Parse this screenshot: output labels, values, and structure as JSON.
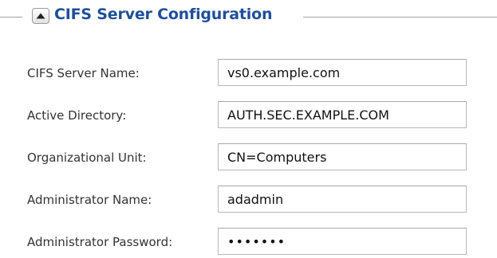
{
  "section": {
    "title": "CIFS Server Configuration",
    "collapse_icon": "triangle-up-icon"
  },
  "fields": [
    {
      "label": "CIFS Server Name:",
      "value": "vs0.example.com"
    },
    {
      "label": "Active Directory:",
      "value": "AUTH.SEC.EXAMPLE.COM"
    },
    {
      "label": "Organizational Unit:",
      "value": "CN=Computers"
    },
    {
      "label": "Administrator Name:",
      "value": "adadmin"
    },
    {
      "label": "Administrator Password:",
      "value": "•••••••"
    }
  ],
  "colors": {
    "title": "#1f4f9a",
    "label": "#333333",
    "input_border": "#b8b8b8"
  }
}
